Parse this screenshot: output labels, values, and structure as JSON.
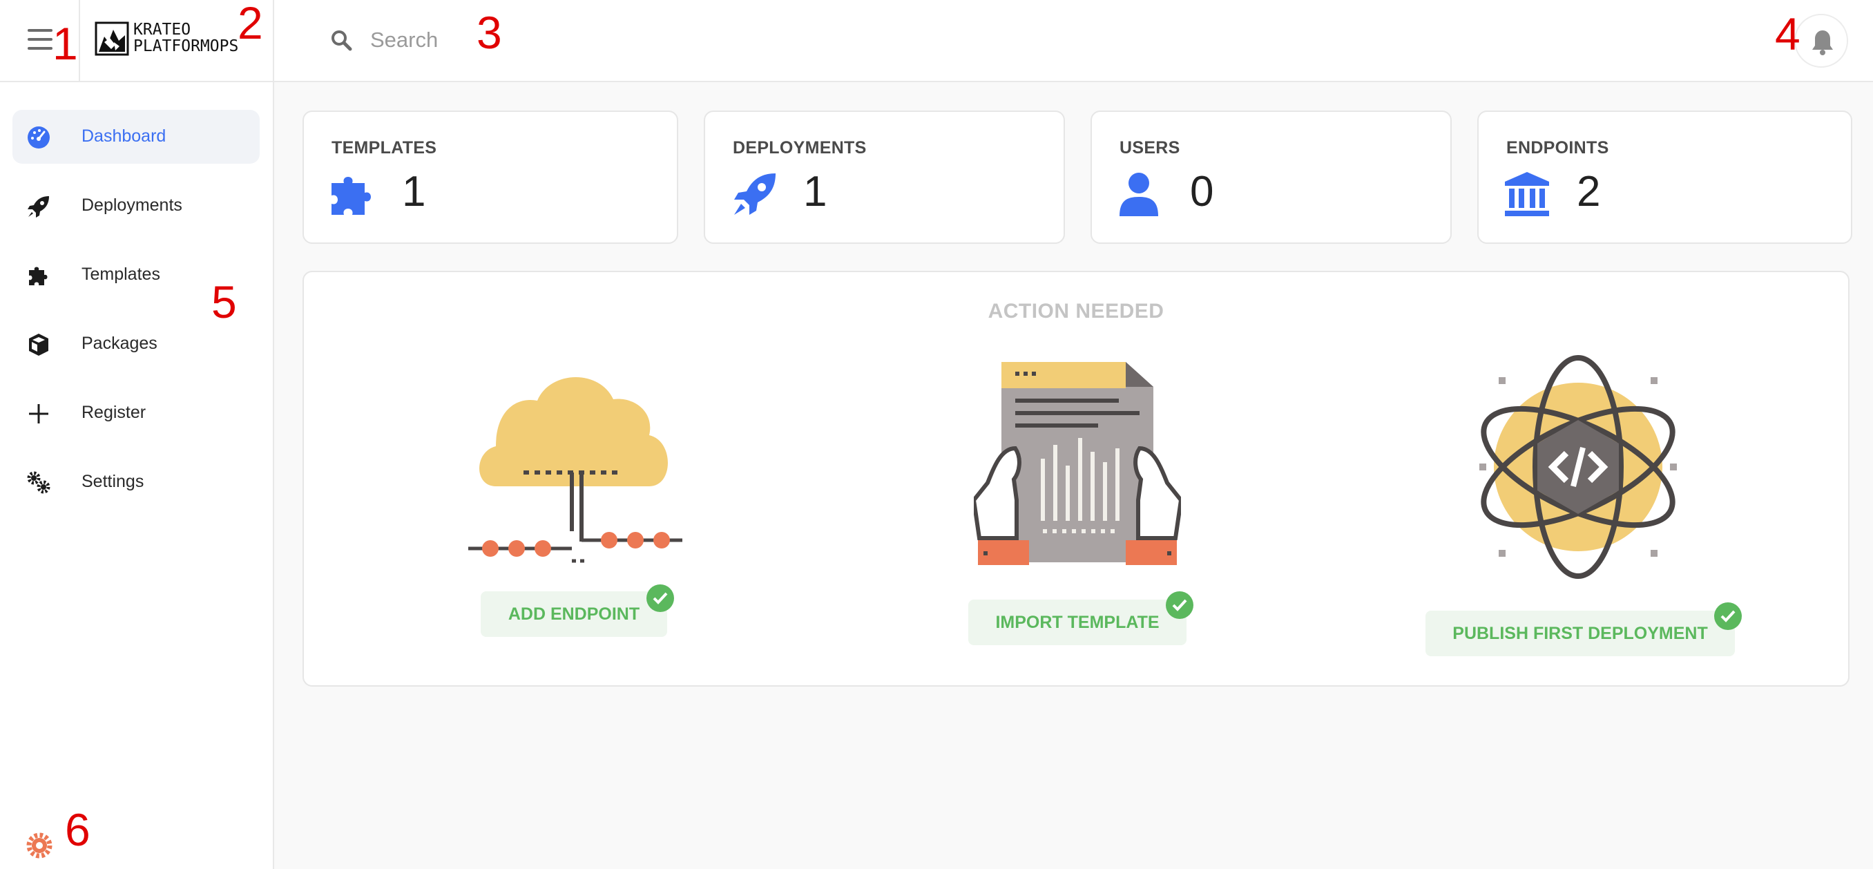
{
  "header": {
    "logo_line1": "KRATEO",
    "logo_line2": "PLATFORMOPS",
    "search_placeholder": "Search"
  },
  "sidebar": {
    "items": [
      {
        "label": "Dashboard",
        "icon": "dashboard-gauge-icon",
        "active": true
      },
      {
        "label": "Deployments",
        "icon": "rocket-icon"
      },
      {
        "label": "Templates",
        "icon": "puzzle-icon"
      },
      {
        "label": "Packages",
        "icon": "cube-icon"
      },
      {
        "label": "Register",
        "icon": "plus-icon"
      },
      {
        "label": "Settings",
        "icon": "cogs-icon"
      }
    ],
    "footer_icon": "gear-icon"
  },
  "stats": [
    {
      "title": "TEMPLATES",
      "value": "1",
      "icon": "puzzle-icon"
    },
    {
      "title": "DEPLOYMENTS",
      "value": "1",
      "icon": "rocket-icon"
    },
    {
      "title": "USERS",
      "value": "0",
      "icon": "user-icon"
    },
    {
      "title": "ENDPOINTS",
      "value": "2",
      "icon": "bank-icon"
    }
  ],
  "actions": {
    "title": "ACTION NEEDED",
    "items": [
      {
        "label": "ADD ENDPOINT",
        "illustration": "cloud-network-illustration",
        "done": true
      },
      {
        "label": "IMPORT TEMPLATE",
        "illustration": "document-hands-illustration",
        "done": true
      },
      {
        "label": "PUBLISH FIRST DEPLOYMENT",
        "illustration": "atom-code-illustration",
        "done": true
      }
    ]
  },
  "annotations": [
    "1",
    "2",
    "3",
    "4",
    "5",
    "6"
  ],
  "colors": {
    "accent": "#3b6ff2",
    "success": "#5bb85d",
    "illustration_yellow": "#f2cd76",
    "illustration_orange": "#ec7853",
    "annotation": "#e00000"
  }
}
